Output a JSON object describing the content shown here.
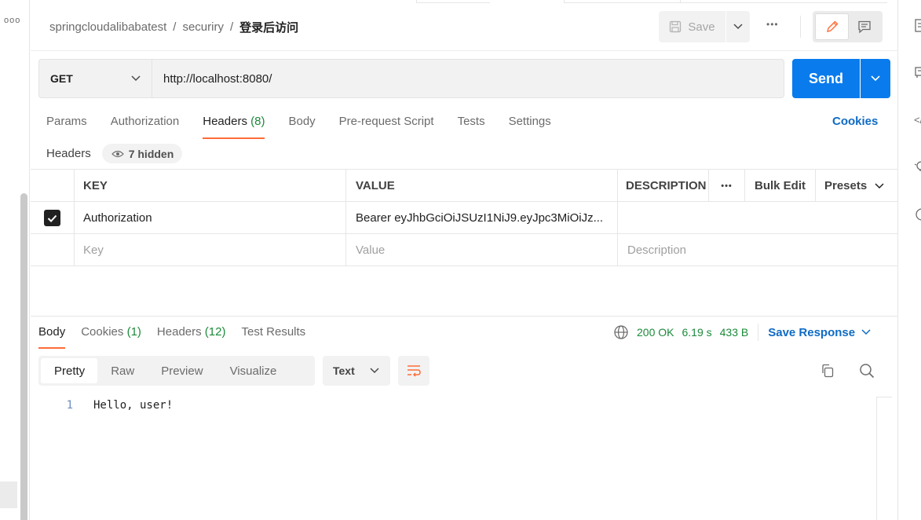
{
  "breadcrumb": {
    "collection": "springcloudalibabatest",
    "folder": "securiry",
    "request": "登录后访问",
    "separator": "/"
  },
  "toolbar": {
    "save_label": "Save",
    "more_label": "•••"
  },
  "request": {
    "method": "GET",
    "url": "http://localhost:8080/",
    "send_label": "Send"
  },
  "request_tabs": [
    {
      "label": "Params",
      "count": ""
    },
    {
      "label": "Authorization",
      "count": ""
    },
    {
      "label": "Headers",
      "count": "(8)"
    },
    {
      "label": "Body",
      "count": ""
    },
    {
      "label": "Pre-request Script",
      "count": ""
    },
    {
      "label": "Tests",
      "count": ""
    },
    {
      "label": "Settings",
      "count": ""
    }
  ],
  "cookies_label": "Cookies",
  "headers_section": {
    "label": "Headers",
    "hidden_label": "7 hidden"
  },
  "headers_table": {
    "columns": {
      "key": "KEY",
      "value": "VALUE",
      "description": "DESCRIPTION",
      "more": "•••",
      "bulk_edit": "Bulk Edit",
      "presets": "Presets"
    },
    "rows": [
      {
        "checked": true,
        "key": "Authorization",
        "value": "Bearer eyJhbGciOiJSUzI1NiJ9.eyJpc3MiOiJz...",
        "description": ""
      }
    ],
    "placeholders": {
      "key": "Key",
      "value": "Value",
      "description": "Description"
    }
  },
  "response_tabs": [
    {
      "label": "Body",
      "count": ""
    },
    {
      "label": "Cookies",
      "count": "(1)"
    },
    {
      "label": "Headers",
      "count": "(12)"
    },
    {
      "label": "Test Results",
      "count": ""
    }
  ],
  "response_meta": {
    "status": "200 OK",
    "time": "6.19 s",
    "size": "433 B",
    "save_response_label": "Save Response"
  },
  "view_modes": [
    "Pretty",
    "Raw",
    "Preview",
    "Visualize"
  ],
  "format": "Text",
  "response_body": [
    {
      "line": "1",
      "text": "Hello, user!"
    }
  ],
  "colors": {
    "accent": "#ff6c37",
    "send": "#097bed",
    "link": "#0f6bc4",
    "success": "#1b8a3a"
  }
}
